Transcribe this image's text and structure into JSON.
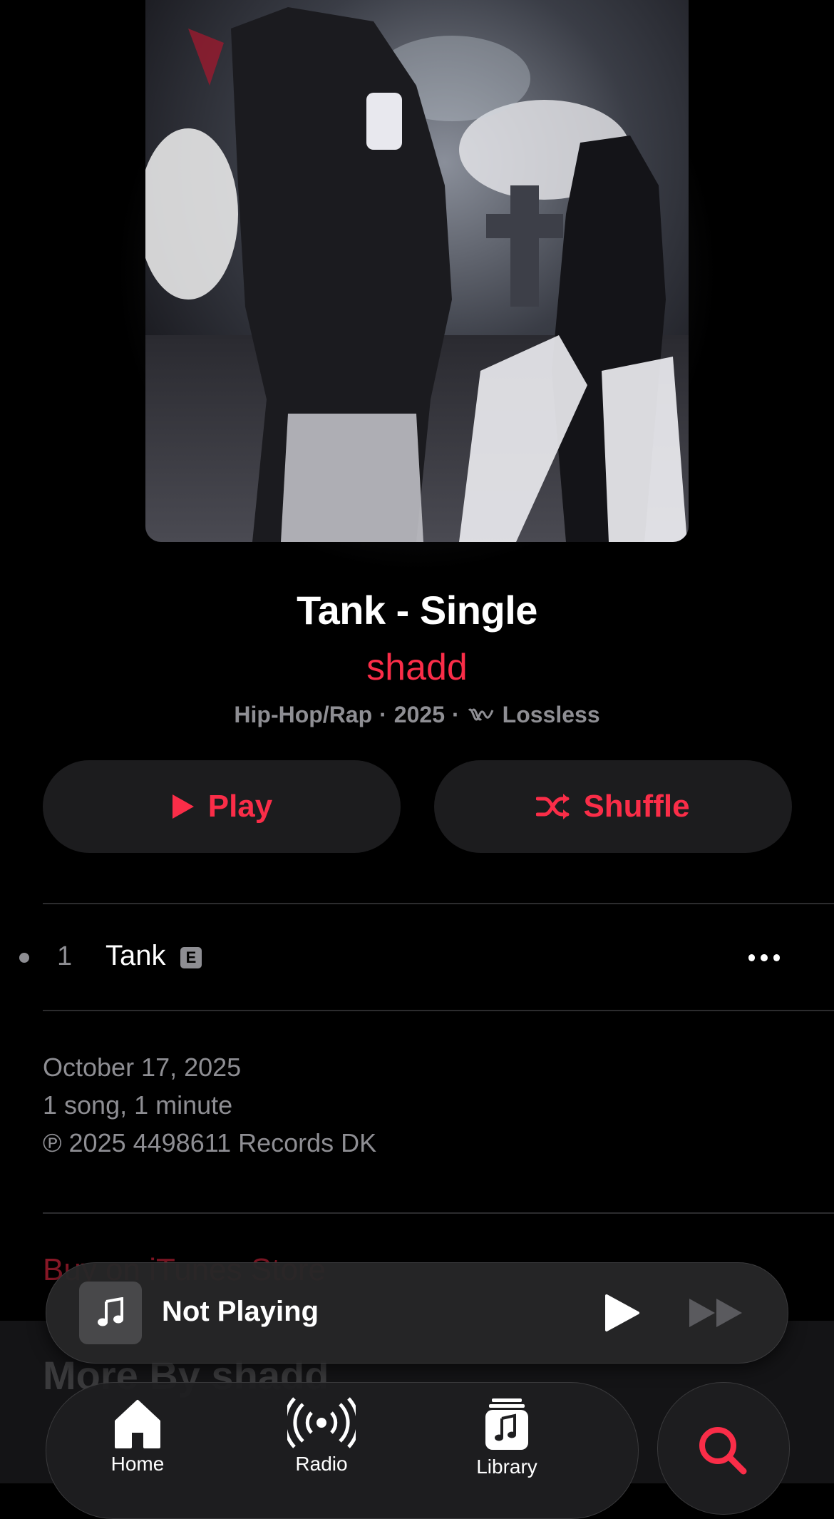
{
  "album": {
    "title": "Tank - Single",
    "artist": "shadd",
    "genre": "Hip-Hop/Rap",
    "year": "2025",
    "quality": "Lossless",
    "separator": "·"
  },
  "actions": {
    "play_label": "Play",
    "shuffle_label": "Shuffle"
  },
  "tracks": [
    {
      "number": "1",
      "title": "Tank",
      "explicit_badge": "E"
    }
  ],
  "info": {
    "release_date": "October 17, 2025",
    "summary": "1 song, 1 minute",
    "copyright": "℗ 2025 4498611 Records DK"
  },
  "links": {
    "buy": "Buy on iTunes Store"
  },
  "more_by": {
    "heading": "More By shadd"
  },
  "mini_player": {
    "status": "Not Playing"
  },
  "tabbar": {
    "home": "Home",
    "radio": "Radio",
    "library": "Library"
  },
  "colors": {
    "accent": "#fa2d48",
    "background": "#000000",
    "secondary_text": "#8e8e93",
    "button_bg": "#1c1c1e"
  },
  "icons": [
    "play-icon",
    "shuffle-icon",
    "lossless-icon",
    "more-icon",
    "music-note-icon",
    "forward-icon",
    "home-icon",
    "radio-icon",
    "library-icon",
    "search-icon"
  ]
}
